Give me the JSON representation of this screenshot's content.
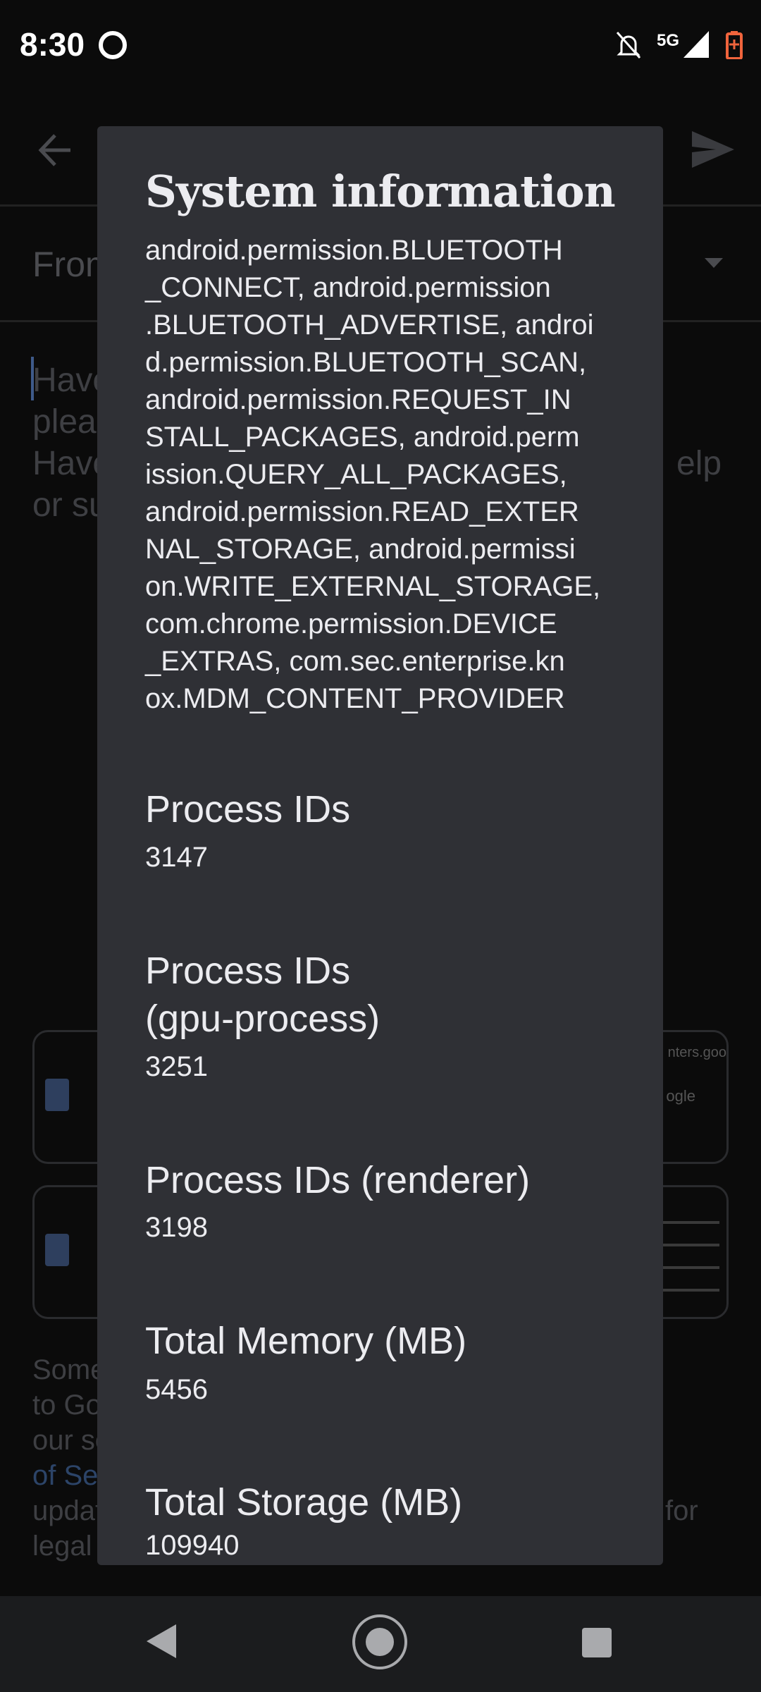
{
  "status_bar": {
    "time": "8:30",
    "network": "5G",
    "icons": [
      "at-sign-icon",
      "bell-off-icon",
      "signal-icon",
      "battery-charging-icon"
    ],
    "battery_color": "#f0643c"
  },
  "background": {
    "from_label": "From",
    "body_lines": [
      "Have",
      "plea",
      "Have",
      "or su"
    ],
    "body_right": [
      "",
      "",
      "elp",
      ""
    ],
    "card1_snippets": [
      "nters.goo",
      "ogle"
    ],
    "footer_lines": [
      "Some",
      "to Go",
      "our se",
      "of Ser",
      "updat",
      "legal"
    ],
    "footer_right": "for"
  },
  "dialog": {
    "title": "System information",
    "permissions_lines": [
      "android.permission.BLUETOOTH",
      "_CONNECT, android.permission",
      ".BLUETOOTH_ADVERTISE, androi",
      "d.permission.BLUETOOTH_SCAN,",
      "android.permission.REQUEST_IN",
      "STALL_PACKAGES, android.perm",
      "ission.QUERY_ALL_PACKAGES,",
      "android.permission.READ_EXTER",
      "NAL_STORAGE, android.permissi",
      "on.WRITE_EXTERNAL_STORAGE,",
      "com.chrome.permission.DEVICE",
      "_EXTRAS, com.sec.enterprise.kn",
      "ox.MDM_CONTENT_PROVIDER"
    ],
    "items": [
      {
        "label": "Process IDs",
        "value": "3147"
      },
      {
        "label": "Process IDs\n(gpu-process)",
        "value": "3251"
      },
      {
        "label": "Process IDs (renderer)",
        "value": "3198"
      },
      {
        "label": "Total Memory (MB)",
        "value": "5456"
      },
      {
        "label": "Total Storage (MB)",
        "value": "109940"
      }
    ]
  }
}
